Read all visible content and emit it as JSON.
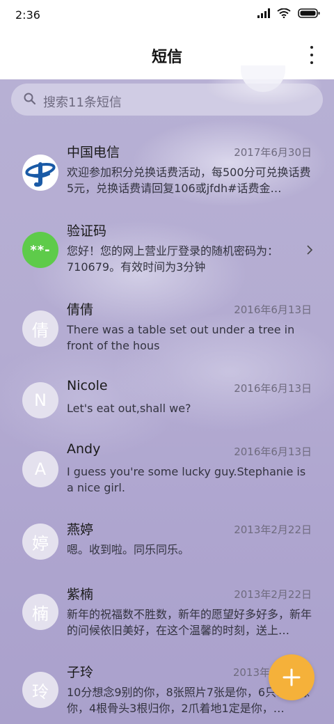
{
  "status": {
    "time": "2:36",
    "icons": [
      "signal-icon",
      "wifi-icon",
      "battery-icon"
    ]
  },
  "header": {
    "title": "短信",
    "menu_icon": "more-vertical-icon"
  },
  "search": {
    "placeholder": "搜索11条短信"
  },
  "messages": [
    {
      "name": "中国电信",
      "date": "2017年6月30日",
      "text": "欢迎参加积分兑换话费活动，每500分可兑换话费5元，兑换话费请回复106或jfdh#话费金…",
      "avatar": "china-telecom-logo"
    },
    {
      "name": "验证码",
      "date": "",
      "text": "您好！您的网上营业厅登录的随机密码为：710679。有效时间为3分钟",
      "avatar_text": "**-"
    },
    {
      "name": "倩倩",
      "date": "2016年6月13日",
      "text": "There was a table set out under a tree in front of the hous",
      "avatar_text": "倩"
    },
    {
      "name": "Nicole",
      "date": "2016年6月13日",
      "text": "Let's eat out,shall we?",
      "avatar_text": "N"
    },
    {
      "name": "Andy",
      "date": "2016年6月13日",
      "text": "I guess you're some lucky guy.Stephanie is a nice girl.",
      "avatar_text": "A"
    },
    {
      "name": "燕婷",
      "date": "2013年2月22日",
      "text": "嗯。收到啦。同乐同乐。",
      "avatar_text": "婷"
    },
    {
      "name": "紫楠",
      "date": "2013年2月22日",
      "text": "新年的祝福数不胜数，新年的愿望好多好多，新年的问候依旧美好，在这个温馨的时刻，送上…",
      "avatar_text": "楠"
    },
    {
      "name": "子玲",
      "date": "2013年",
      "text": "10分想念9别的你，8张照片7张是你，6只…只像你，4根骨头3根归你，2爪着地1定是你，…",
      "avatar_text": "玲"
    }
  ],
  "colors": {
    "fab": "#f5b13a",
    "verify_avatar": "#5ecb4a",
    "telecom_blue": "#1a5aa6"
  },
  "fab": {
    "icon": "plus-icon"
  }
}
